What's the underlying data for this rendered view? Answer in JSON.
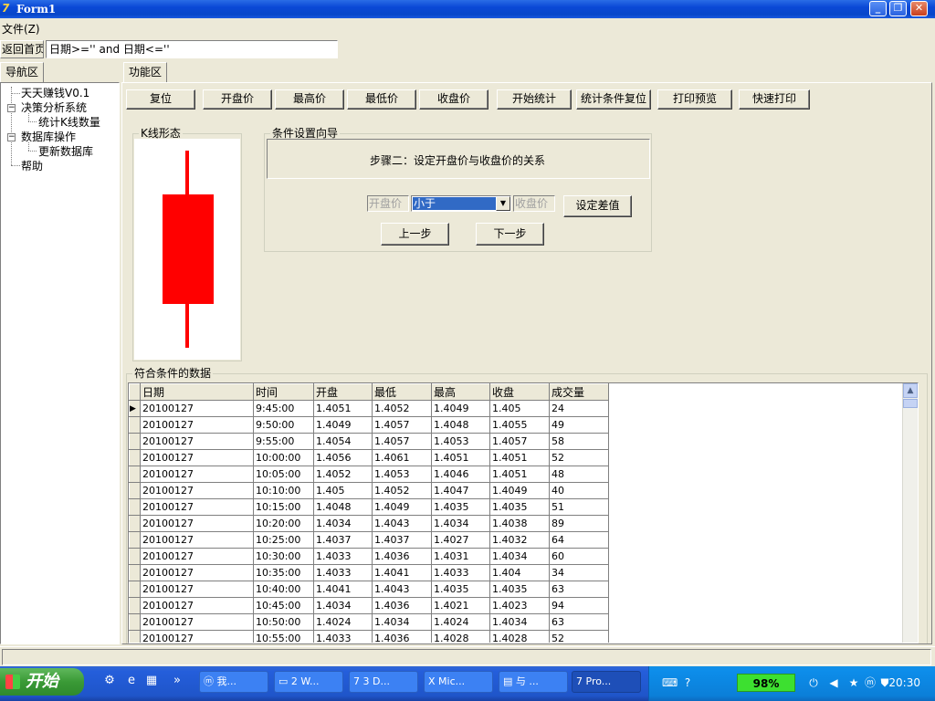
{
  "window": {
    "title": "Form1"
  },
  "menu": {
    "file": "文件(Z)"
  },
  "toolbar": {
    "back_label": "返回首页",
    "condition_value": "日期>='' and 日期<=''"
  },
  "tabs": {
    "nav": "导航区",
    "func": "功能区"
  },
  "tree": {
    "items": [
      {
        "label": "天天赚钱V0.1"
      },
      {
        "label": "决策分析系统"
      },
      {
        "label": "统计K线数量"
      },
      {
        "label": "数据库操作"
      },
      {
        "label": "更新数据库"
      },
      {
        "label": "帮助"
      }
    ]
  },
  "buttons": [
    "复位",
    "开盘价",
    "最高价",
    "最低价",
    "收盘价",
    "开始统计",
    "统计条件复位",
    "打印预览",
    "快速打印"
  ],
  "kline": {
    "title": "K线形态",
    "candle_color": "#FF0000"
  },
  "wizard": {
    "title": "条件设置向导",
    "step": "步骤二：设定开盘价与收盘价的关系",
    "left_field": "开盘价",
    "relation": "小于",
    "right_field": "收盘价",
    "set_diff": "设定差值",
    "prev": "上一步",
    "next": "下一步"
  },
  "results": {
    "title": "符合条件的数据",
    "columns": [
      "日期",
      "时间",
      "开盘",
      "最低",
      "最高",
      "收盘",
      "成交量"
    ],
    "rows": [
      [
        "20100127",
        "9:45:00",
        "1.4051",
        "1.4052",
        "1.4049",
        "1.405",
        "24"
      ],
      [
        "20100127",
        "9:50:00",
        "1.4049",
        "1.4057",
        "1.4048",
        "1.4055",
        "49"
      ],
      [
        "20100127",
        "9:55:00",
        "1.4054",
        "1.4057",
        "1.4053",
        "1.4057",
        "58"
      ],
      [
        "20100127",
        "10:00:00",
        "1.4056",
        "1.4061",
        "1.4051",
        "1.4051",
        "52"
      ],
      [
        "20100127",
        "10:05:00",
        "1.4052",
        "1.4053",
        "1.4046",
        "1.4051",
        "48"
      ],
      [
        "20100127",
        "10:10:00",
        "1.405",
        "1.4052",
        "1.4047",
        "1.4049",
        "40"
      ],
      [
        "20100127",
        "10:15:00",
        "1.4048",
        "1.4049",
        "1.4035",
        "1.4035",
        "51"
      ],
      [
        "20100127",
        "10:20:00",
        "1.4034",
        "1.4043",
        "1.4034",
        "1.4038",
        "89"
      ],
      [
        "20100127",
        "10:25:00",
        "1.4037",
        "1.4037",
        "1.4027",
        "1.4032",
        "64"
      ],
      [
        "20100127",
        "10:30:00",
        "1.4033",
        "1.4036",
        "1.4031",
        "1.4034",
        "60"
      ],
      [
        "20100127",
        "10:35:00",
        "1.4033",
        "1.4041",
        "1.4033",
        "1.404",
        "34"
      ],
      [
        "20100127",
        "10:40:00",
        "1.4041",
        "1.4043",
        "1.4035",
        "1.4035",
        "63"
      ],
      [
        "20100127",
        "10:45:00",
        "1.4034",
        "1.4036",
        "1.4021",
        "1.4023",
        "94"
      ],
      [
        "20100127",
        "10:50:00",
        "1.4024",
        "1.4034",
        "1.4024",
        "1.4034",
        "63"
      ],
      [
        "20100127",
        "10:55:00",
        "1.4033",
        "1.4036",
        "1.4028",
        "1.4028",
        "52"
      ]
    ]
  },
  "taskbar": {
    "start": "开始",
    "tasks": [
      "我...",
      "2 W...",
      "3 D...",
      "Mic...",
      "与 ...",
      "Pro..."
    ],
    "battery": "98%",
    "clock": "20:30"
  }
}
